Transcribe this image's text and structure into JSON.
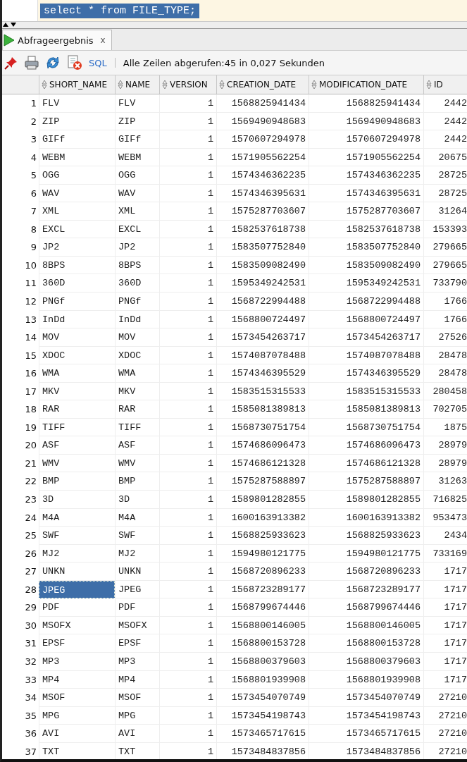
{
  "editor": {
    "query": "select * from FILE_TYPE;"
  },
  "tabs": [
    {
      "label": "Abfrageergebnis",
      "close": "x",
      "selected": true
    }
  ],
  "toolbar": {
    "sql_link": "SQL",
    "status": "Alle Zeilen abgerufen:45 in 0,027 Sekunden"
  },
  "table": {
    "columns": [
      "SHORT_NAME",
      "NAME",
      "VERSION",
      "CREATION_DATE",
      "MODIFICATION_DATE",
      "ID"
    ],
    "rows": [
      {
        "num": "1",
        "cells": [
          "FLV",
          "FLV",
          "1",
          "1568825941434",
          "1568825941434",
          "2442"
        ],
        "selected": false
      },
      {
        "num": "2",
        "cells": [
          "ZIP",
          "ZIP",
          "1",
          "1569490948683",
          "1569490948683",
          "2442"
        ],
        "selected": false
      },
      {
        "num": "3",
        "cells": [
          "GIFf",
          "GIFf",
          "1",
          "1570607294978",
          "1570607294978",
          "2442"
        ],
        "selected": false
      },
      {
        "num": "4",
        "cells": [
          "WEBM",
          "WEBM",
          "1",
          "1571905562254",
          "1571905562254",
          "20675"
        ],
        "selected": false
      },
      {
        "num": "5",
        "cells": [
          "OGG",
          "OGG",
          "1",
          "1574346362235",
          "1574346362235",
          "28725"
        ],
        "selected": false
      },
      {
        "num": "6",
        "cells": [
          "WAV",
          "WAV",
          "1",
          "1574346395631",
          "1574346395631",
          "28725"
        ],
        "selected": false
      },
      {
        "num": "7",
        "cells": [
          "XML",
          "XML",
          "1",
          "1575287703607",
          "1575287703607",
          "31264"
        ],
        "selected": false
      },
      {
        "num": "8",
        "cells": [
          "EXCL",
          "EXCL",
          "1",
          "1582537618738",
          "1582537618738",
          "153393"
        ],
        "selected": false
      },
      {
        "num": "9",
        "cells": [
          "JP2",
          "JP2",
          "1",
          "1583507752840",
          "1583507752840",
          "279665"
        ],
        "selected": false
      },
      {
        "num": "10",
        "cells": [
          "8BPS",
          "8BPS",
          "1",
          "1583509082490",
          "1583509082490",
          "279665"
        ],
        "selected": false
      },
      {
        "num": "11",
        "cells": [
          "360D",
          "360D",
          "1",
          "1595349242531",
          "1595349242531",
          "733790"
        ],
        "selected": false
      },
      {
        "num": "12",
        "cells": [
          "PNGf",
          "PNGf",
          "1",
          "1568722994488",
          "1568722994488",
          "1766"
        ],
        "selected": false
      },
      {
        "num": "13",
        "cells": [
          "InDd",
          "InDd",
          "1",
          "1568800724497",
          "1568800724497",
          "1766"
        ],
        "selected": false
      },
      {
        "num": "14",
        "cells": [
          "MOV",
          "MOV",
          "1",
          "1573454263717",
          "1573454263717",
          "27526"
        ],
        "selected": false
      },
      {
        "num": "15",
        "cells": [
          "XDOC",
          "XDOC",
          "1",
          "1574087078488",
          "1574087078488",
          "28478"
        ],
        "selected": false
      },
      {
        "num": "16",
        "cells": [
          "WMA",
          "WMA",
          "1",
          "1574346395529",
          "1574346395529",
          "28478"
        ],
        "selected": false
      },
      {
        "num": "17",
        "cells": [
          "MKV",
          "MKV",
          "1",
          "1583515315533",
          "1583515315533",
          "280458"
        ],
        "selected": false
      },
      {
        "num": "18",
        "cells": [
          "RAR",
          "RAR",
          "1",
          "1585081389813",
          "1585081389813",
          "702705"
        ],
        "selected": false
      },
      {
        "num": "19",
        "cells": [
          "TIFF",
          "TIFF",
          "1",
          "1568730751754",
          "1568730751754",
          "1875"
        ],
        "selected": false
      },
      {
        "num": "20",
        "cells": [
          "ASF",
          "ASF",
          "1",
          "1574686096473",
          "1574686096473",
          "28979"
        ],
        "selected": false
      },
      {
        "num": "21",
        "cells": [
          "WMV",
          "WMV",
          "1",
          "1574686121328",
          "1574686121328",
          "28979"
        ],
        "selected": false
      },
      {
        "num": "22",
        "cells": [
          "BMP",
          "BMP",
          "1",
          "1575287588897",
          "1575287588897",
          "31263"
        ],
        "selected": false
      },
      {
        "num": "23",
        "cells": [
          "3D",
          "3D",
          "1",
          "1589801282855",
          "1589801282855",
          "716825"
        ],
        "selected": false
      },
      {
        "num": "24",
        "cells": [
          "M4A",
          "M4A",
          "1",
          "1600163913382",
          "1600163913382",
          "953473"
        ],
        "selected": false
      },
      {
        "num": "25",
        "cells": [
          "SWF",
          "SWF",
          "1",
          "1568825933623",
          "1568825933623",
          "2434"
        ],
        "selected": false
      },
      {
        "num": "26",
        "cells": [
          "MJ2",
          "MJ2",
          "1",
          "1594980121775",
          "1594980121775",
          "733169"
        ],
        "selected": false
      },
      {
        "num": "27",
        "cells": [
          "UNKN",
          "UNKN",
          "1",
          "1568720896233",
          "1568720896233",
          "1717"
        ],
        "selected": false
      },
      {
        "num": "28",
        "cells": [
          "JPEG",
          "JPEG",
          "1",
          "1568723289177",
          "1568723289177",
          "1717"
        ],
        "selected": true
      },
      {
        "num": "29",
        "cells": [
          "PDF",
          "PDF",
          "1",
          "1568799674446",
          "1568799674446",
          "1717"
        ],
        "selected": false
      },
      {
        "num": "30",
        "cells": [
          "MSOFX",
          "MSOFX",
          "1",
          "1568800146005",
          "1568800146005",
          "1717"
        ],
        "selected": false
      },
      {
        "num": "31",
        "cells": [
          "EPSF",
          "EPSF",
          "1",
          "1568800153728",
          "1568800153728",
          "1717"
        ],
        "selected": false
      },
      {
        "num": "32",
        "cells": [
          "MP3",
          "MP3",
          "1",
          "1568800379603",
          "1568800379603",
          "1717"
        ],
        "selected": false
      },
      {
        "num": "33",
        "cells": [
          "MP4",
          "MP4",
          "1",
          "1568801939908",
          "1568801939908",
          "1717"
        ],
        "selected": false
      },
      {
        "num": "34",
        "cells": [
          "MSOF",
          "MSOF",
          "1",
          "1573454070749",
          "1573454070749",
          "27210"
        ],
        "selected": false
      },
      {
        "num": "35",
        "cells": [
          "MPG",
          "MPG",
          "1",
          "1573454198743",
          "1573454198743",
          "27210"
        ],
        "selected": false
      },
      {
        "num": "36",
        "cells": [
          "AVI",
          "AVI",
          "1",
          "1573465717615",
          "1573465717615",
          "27210"
        ],
        "selected": false
      },
      {
        "num": "37",
        "cells": [
          "TXT",
          "TXT",
          "1",
          "1573484837856",
          "1573484837856",
          "27210"
        ],
        "selected": false
      }
    ]
  }
}
